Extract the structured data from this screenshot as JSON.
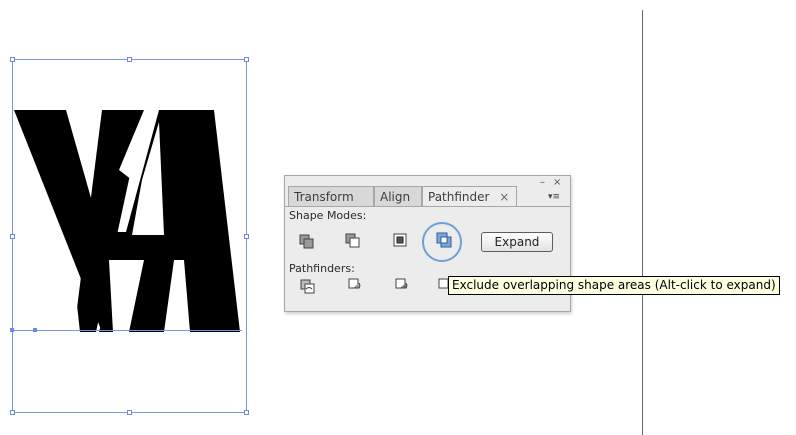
{
  "panel": {
    "tabs": [
      {
        "label": "Transform",
        "active": false
      },
      {
        "label": "Align",
        "active": false
      },
      {
        "label": "Pathfinder",
        "active": true
      }
    ],
    "tab_close_glyph": "×",
    "minimize_glyph": "–",
    "close_glyph": "×",
    "menu_glyph": "▾≡",
    "shape_modes_label": "Shape Modes:",
    "pathfinders_label": "Pathfinders:",
    "expand_label": "Expand",
    "shape_mode_icons": [
      "unite-icon",
      "minus-front-icon",
      "intersect-icon",
      "exclude-icon"
    ],
    "pathfinder_icons": [
      "divide-icon",
      "trim-icon",
      "merge-icon",
      "crop-icon",
      "outline-icon",
      "minus-back-icon"
    ],
    "highlighted_icon": "exclude-icon"
  },
  "tooltip": {
    "text": "Exclude overlapping shape areas (Alt-click to expand)"
  },
  "colors": {
    "selection": "#7a96e8",
    "highlight": "#6fa0d4",
    "tooltip_bg": "#ffffe1"
  }
}
